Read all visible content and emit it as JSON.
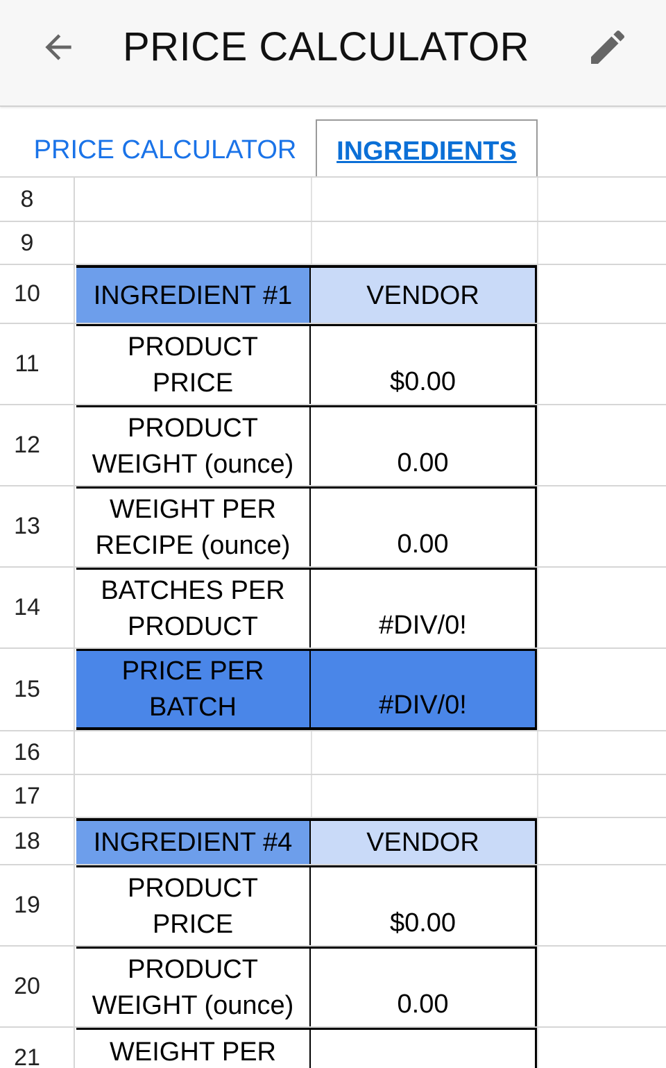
{
  "app": {
    "title": "PRICE CALCULATOR",
    "back_icon": "arrow-left-icon",
    "edit_icon": "pencil-icon"
  },
  "tabs": [
    {
      "label": "PRICE CALCULATOR",
      "active": false
    },
    {
      "label": "INGREDIENTS",
      "active": true
    }
  ],
  "colors": {
    "header_dark": "#6d9eeb",
    "header_light": "#c9daf8",
    "highlight": "#4a86e8",
    "link": "#1a73e8"
  },
  "rows": {
    "r8": "8",
    "r9": "9",
    "r10": "10",
    "r11": "11",
    "r12": "12",
    "r13": "13",
    "r14": "14",
    "r15": "15",
    "r16": "16",
    "r17": "17",
    "r18": "18",
    "r19": "19",
    "r20": "20",
    "r21": "21"
  },
  "table1": {
    "title": "INGREDIENT #1",
    "vendor": "VENDOR",
    "product_price": {
      "label1": "PRODUCT",
      "label2": "PRICE",
      "value": "$0.00"
    },
    "product_weight": {
      "label1": "PRODUCT",
      "label2": "WEIGHT (ounce)",
      "value": "0.00"
    },
    "weight_per_recipe": {
      "label1": "WEIGHT PER",
      "label2": "RECIPE (ounce)",
      "value": "0.00"
    },
    "batches_per_product": {
      "label1": "BATCHES PER",
      "label2": "PRODUCT",
      "value": "#DIV/0!"
    },
    "price_per_batch": {
      "label1": "PRICE PER",
      "label2": "BATCH",
      "value": "#DIV/0!"
    }
  },
  "table2": {
    "title": "INGREDIENT #4",
    "vendor": "VENDOR",
    "product_price": {
      "label1": "PRODUCT",
      "label2": "PRICE",
      "value": "$0.00"
    },
    "product_weight": {
      "label1": "PRODUCT",
      "label2": "WEIGHT (ounce)",
      "value": "0.00"
    },
    "weight_per_recipe": {
      "label1": "WEIGHT PER"
    }
  }
}
